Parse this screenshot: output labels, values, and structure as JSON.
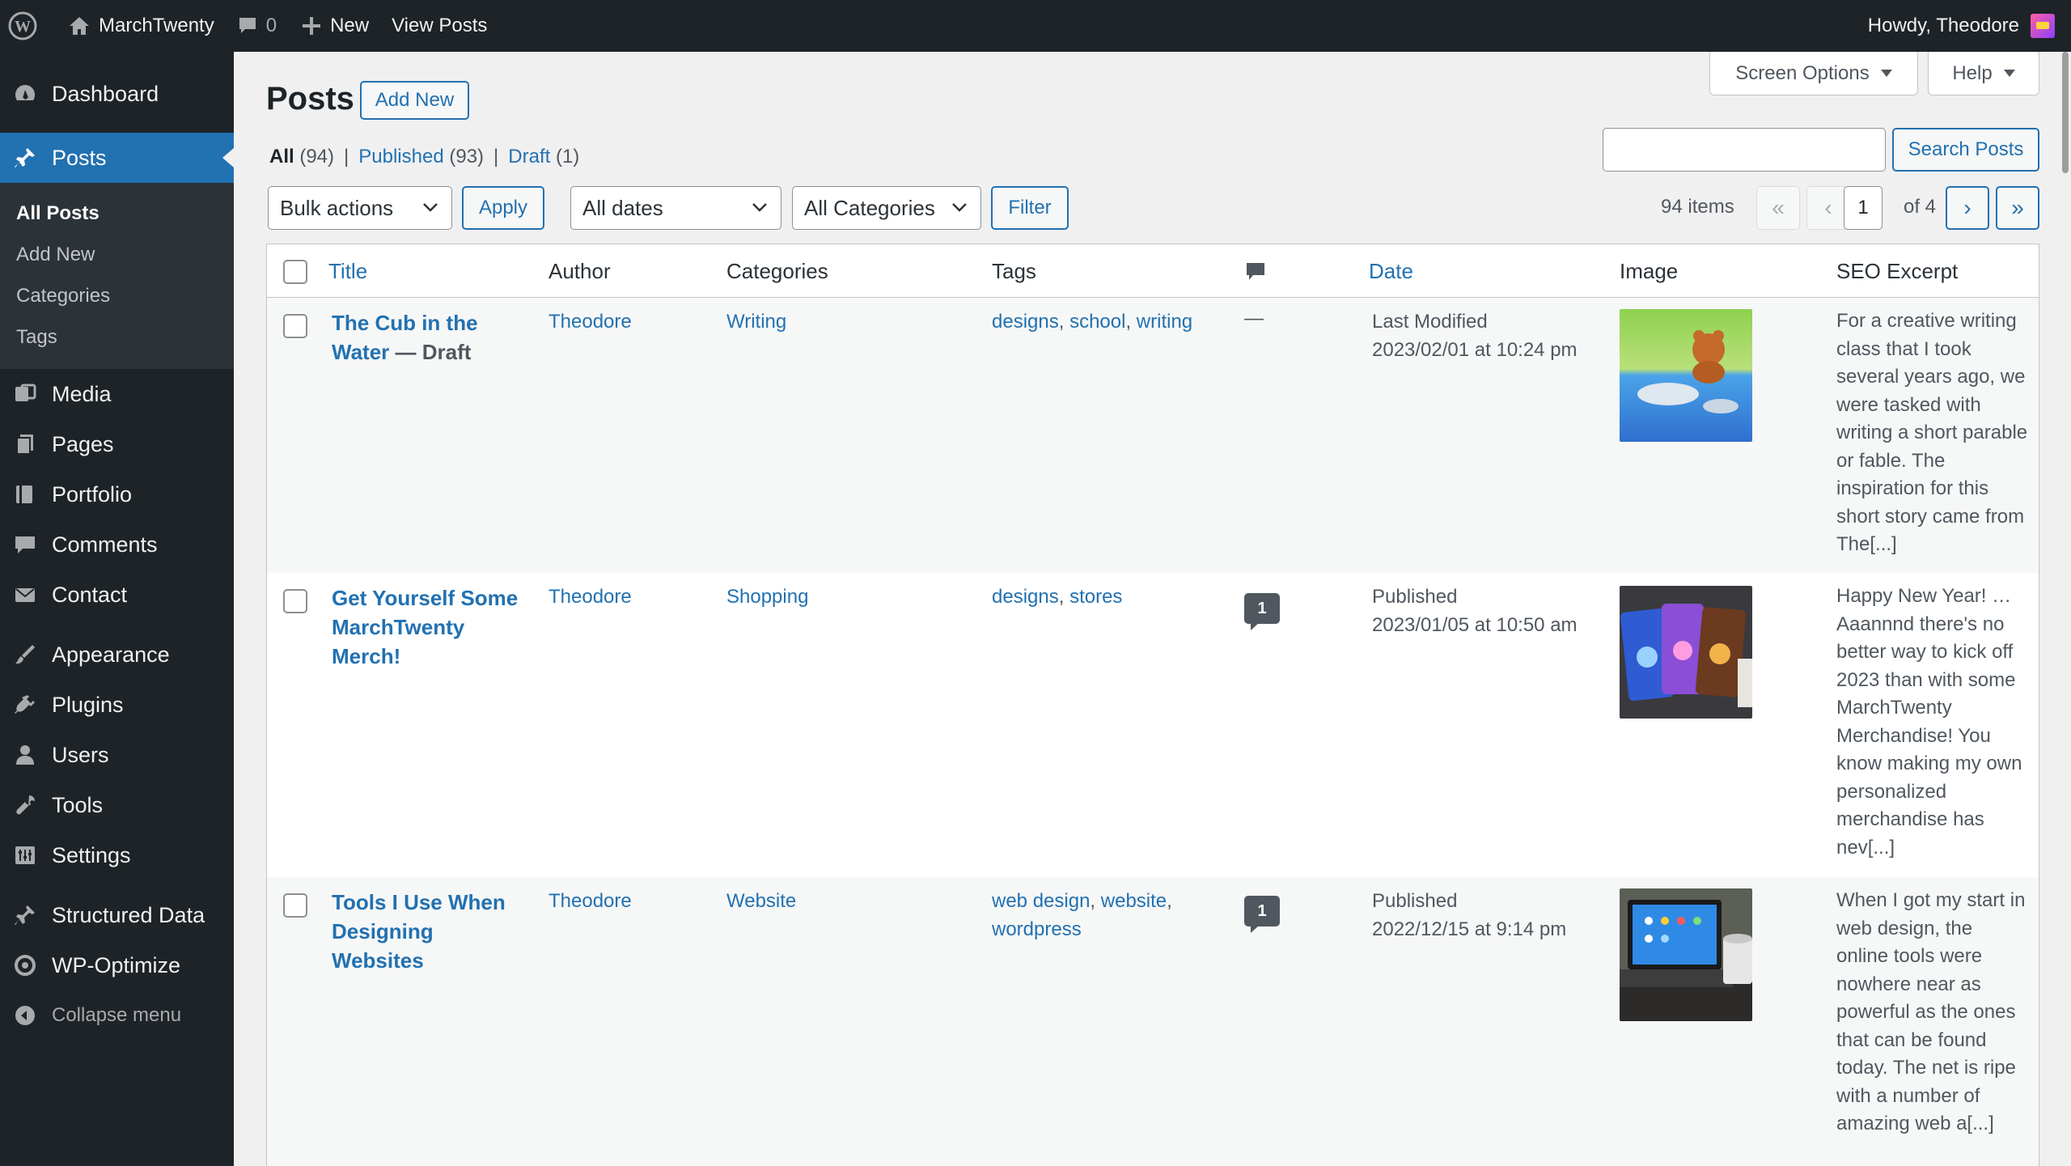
{
  "adminbar": {
    "site_name": "MarchTwenty",
    "comments_count": "0",
    "new_label": "New",
    "view_posts_label": "View Posts",
    "greeting": "Howdy, Theodore"
  },
  "sidebar": {
    "items": [
      {
        "label": "Dashboard",
        "icon": "dashboard-icon"
      },
      {
        "label": "Posts",
        "icon": "pin-icon"
      },
      {
        "label": "Media",
        "icon": "media-icon"
      },
      {
        "label": "Pages",
        "icon": "pages-icon"
      },
      {
        "label": "Portfolio",
        "icon": "portfolio-icon"
      },
      {
        "label": "Comments",
        "icon": "comment-icon"
      },
      {
        "label": "Contact",
        "icon": "envelope-icon"
      },
      {
        "label": "Appearance",
        "icon": "brush-icon"
      },
      {
        "label": "Plugins",
        "icon": "plug-icon"
      },
      {
        "label": "Users",
        "icon": "user-icon"
      },
      {
        "label": "Tools",
        "icon": "wrench-icon"
      },
      {
        "label": "Settings",
        "icon": "settings-icon"
      },
      {
        "label": "Structured Data",
        "icon": "pin-icon"
      },
      {
        "label": "WP-Optimize",
        "icon": "optimize-icon"
      }
    ],
    "posts_submenu": [
      "All Posts",
      "Add New",
      "Categories",
      "Tags"
    ],
    "collapse_label": "Collapse menu"
  },
  "header": {
    "screen_options": "Screen Options",
    "help": "Help",
    "title": "Posts",
    "add_new": "Add New"
  },
  "views": {
    "all_label": "All",
    "all_count": "(94)",
    "published_label": "Published",
    "published_count": "(93)",
    "draft_label": "Draft",
    "draft_count": "(1)",
    "separator": "|"
  },
  "filters": {
    "bulk_actions": "Bulk actions",
    "apply": "Apply",
    "dates": "All dates",
    "categories": "All Categories",
    "filter": "Filter",
    "search_button": "Search Posts",
    "search_value": ""
  },
  "pagination": {
    "items": "94 items",
    "first": "«",
    "prev": "‹",
    "current": "1",
    "of": "of 4",
    "next": "›",
    "last": "»"
  },
  "table": {
    "columns": {
      "title": "Title",
      "author": "Author",
      "categories": "Categories",
      "tags": "Tags",
      "date": "Date",
      "image": "Image",
      "seo_excerpt": "SEO Excerpt"
    },
    "rows": [
      {
        "title_line1": "The Cub in the",
        "title_line2": "Water",
        "state": " — Draft",
        "author": "Theodore",
        "category": "Writing",
        "tags": [
          "designs",
          "school",
          "writing"
        ],
        "comments": "—",
        "date_status": "Last Modified",
        "date_value": "2023/02/01 at 10:24 pm",
        "image_alt": "bear cub and seal illustration",
        "excerpt": "For a creative writing class that I took several years ago, we were tasked with writing a short parable or fable. The inspiration for this short story came from The[...]"
      },
      {
        "title_line1": "Get Yourself Some",
        "title_line2": "MarchTwenty",
        "title_line3": "Merch!",
        "author": "Theodore",
        "category": "Shopping",
        "tags": [
          "designs",
          "stores"
        ],
        "comments": "1",
        "date_status": "Published",
        "date_value": "2023/01/05 at 10:50 am",
        "image_alt": "merchandise bags",
        "excerpt": "Happy New Year!  … Aaannnd there's no better way to kick off 2023 than with some MarchTwenty Merchandise! You know making my own personalized merchandise has nev[...]"
      },
      {
        "title_line1": "Tools I Use When",
        "title_line2": "Designing",
        "title_line3": "Websites",
        "author": "Theodore",
        "category": "Website",
        "tags": [
          "web design",
          "website",
          "wordpress"
        ],
        "comments": "1",
        "date_status": "Published",
        "date_value": "2022/12/15 at 9:14 pm",
        "image_alt": "laptop with mug",
        "excerpt": "When I got my start in web design, the online tools were nowhere near as powerful as the ones that can be found today. The net is ripe with a number of amazing web a[...]"
      }
    ]
  },
  "colors": {
    "admin_dark": "#1d2327",
    "accent": "#2271b1",
    "background": "#f0f0f1"
  }
}
